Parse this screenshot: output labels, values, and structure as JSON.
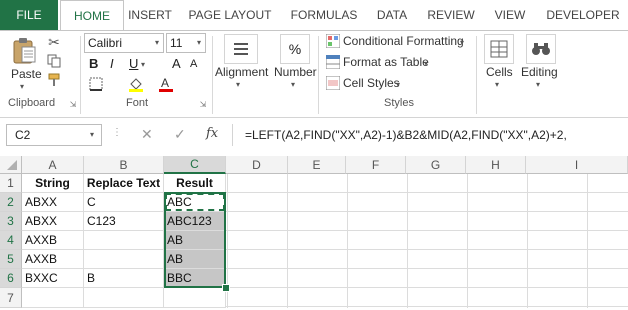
{
  "tabs": [
    "FILE",
    "HOME",
    "INSERT",
    "PAGE LAYOUT",
    "FORMULAS",
    "DATA",
    "REVIEW",
    "VIEW",
    "DEVELOPER"
  ],
  "active_tab": "HOME",
  "clipboard": {
    "paste_label": "Paste",
    "group_label": "Clipboard"
  },
  "font": {
    "name": "Calibri",
    "size": "11",
    "group_label": "Font",
    "bold": "B",
    "italic": "I",
    "underline": "U",
    "grow": "A",
    "shrink": "A"
  },
  "alignment": {
    "label": "Alignment"
  },
  "number": {
    "label": "Number",
    "symbol": "%"
  },
  "styles": {
    "conditional": "Conditional Formatting",
    "format_table": "Format as Table",
    "cell_styles": "Cell Styles",
    "group_label": "Styles"
  },
  "cells": {
    "label": "Cells"
  },
  "editing": {
    "label": "Editing"
  },
  "formula_bar": {
    "name_box": "C2",
    "fx": "fx",
    "formula": "=LEFT(A2,FIND(\"XX\",A2)-1)&B2&MID(A2,FIND(\"XX\",A2)+2,"
  },
  "sheet": {
    "columns": [
      "A",
      "B",
      "C",
      "D",
      "E",
      "F",
      "G",
      "H",
      "I"
    ],
    "rows": [
      "1",
      "2",
      "3",
      "4",
      "5",
      "6",
      "7"
    ],
    "data": [
      [
        "String",
        "Replace Text",
        "Result"
      ],
      [
        "ABXX",
        "C",
        "ABC"
      ],
      [
        "ABXX",
        "C123",
        "ABC123"
      ],
      [
        "AXXB",
        "",
        "AB"
      ],
      [
        "AXXB",
        "",
        "AB"
      ],
      [
        "BXXC",
        "B",
        "BBC"
      ],
      [
        "",
        "",
        ""
      ]
    ]
  },
  "colors": {
    "accent": "#217346",
    "selection_fill": "#c6c6c6"
  }
}
